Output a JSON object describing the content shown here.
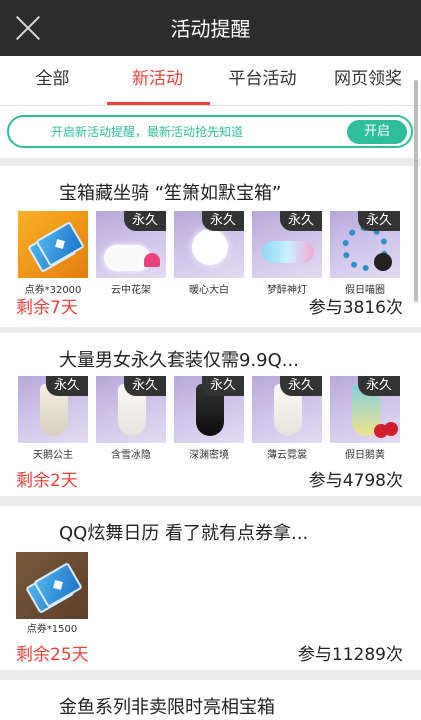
{
  "header": {
    "title": "活动提醒"
  },
  "tabs": [
    {
      "label": "全部",
      "active": false
    },
    {
      "label": "新活动",
      "active": true
    },
    {
      "label": "平台活动",
      "active": false
    },
    {
      "label": "网页领奖",
      "active": false
    }
  ],
  "notify": {
    "text": "开启新活动提醒，最新活动抢先知道",
    "button": "开启"
  },
  "activities": [
    {
      "title": "宝箱藏坐骑 “笙箫如默宝箱”",
      "items": [
        {
          "label": "点券*32000",
          "badge": ""
        },
        {
          "label": "云中花架",
          "badge": "永久"
        },
        {
          "label": "暖心大白",
          "badge": "永久"
        },
        {
          "label": "梦醉神灯",
          "badge": "永久"
        },
        {
          "label": "假日喵圈",
          "badge": "永久"
        }
      ],
      "remaining": "剩余7天",
      "participants": "参与3816次"
    },
    {
      "title": "大量男女永久套装仅需9.9Q...",
      "items": [
        {
          "label": "天鹅公主",
          "badge": "永久"
        },
        {
          "label": "含雪冰隐",
          "badge": "永久"
        },
        {
          "label": "深渊密境",
          "badge": "永久"
        },
        {
          "label": "薄云霓裳",
          "badge": "永久"
        },
        {
          "label": "假日鹅黄",
          "badge": "永久"
        }
      ],
      "remaining": "剩余2天",
      "participants": "参与4798次"
    },
    {
      "title": "QQ炫舞日历 看了就有点券拿...",
      "items": [
        {
          "label": "点券*1500",
          "badge": ""
        }
      ],
      "remaining": "剩余25天",
      "participants": "参与11289次"
    },
    {
      "title": "金鱼系列非卖限时亮相宝箱",
      "items": [],
      "remaining": "",
      "participants": ""
    }
  ],
  "colors": {
    "accent": "#e9423e",
    "notify_green": "#2dbf9c",
    "header_bg": "#2d2d2d"
  },
  "icons": {
    "close": "close-icon",
    "ticket": "ticket-icon"
  }
}
